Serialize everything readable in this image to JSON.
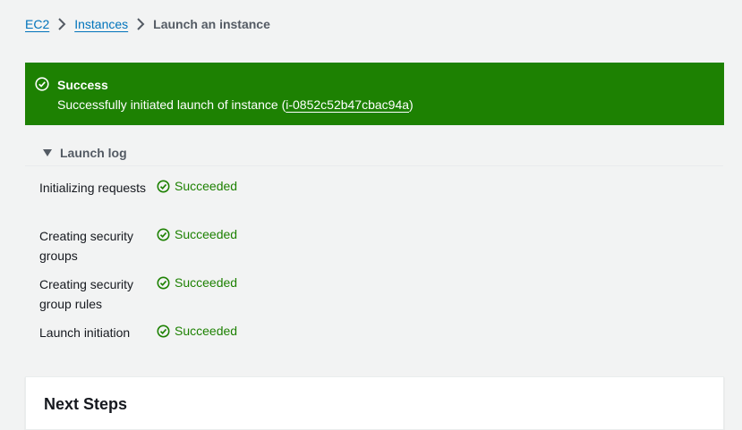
{
  "breadcrumb": {
    "items": [
      {
        "label": "EC2",
        "link": true
      },
      {
        "label": "Instances",
        "link": true
      },
      {
        "label": "Launch an instance",
        "link": false
      }
    ]
  },
  "flash": {
    "type": "success",
    "title": "Success",
    "message_prefix": "Successfully initiated launch of instance (",
    "instance_id": "i-0852c52b47cbac94a",
    "message_suffix": ")",
    "background_color": "#1d8102",
    "icon": "check-circle-icon"
  },
  "launch_log": {
    "title": "Launch log",
    "expanded": true,
    "rows": [
      {
        "label": "Initializing requests",
        "status": "Succeeded"
      },
      {
        "label": "Creating security groups",
        "status": "Succeeded"
      },
      {
        "label": "Creating security group rules",
        "status": "Succeeded"
      },
      {
        "label": "Launch initiation",
        "status": "Succeeded"
      }
    ],
    "status_color": "#1d8102",
    "status_icon": "check-circle-icon"
  },
  "next_steps": {
    "title": "Next Steps"
  }
}
